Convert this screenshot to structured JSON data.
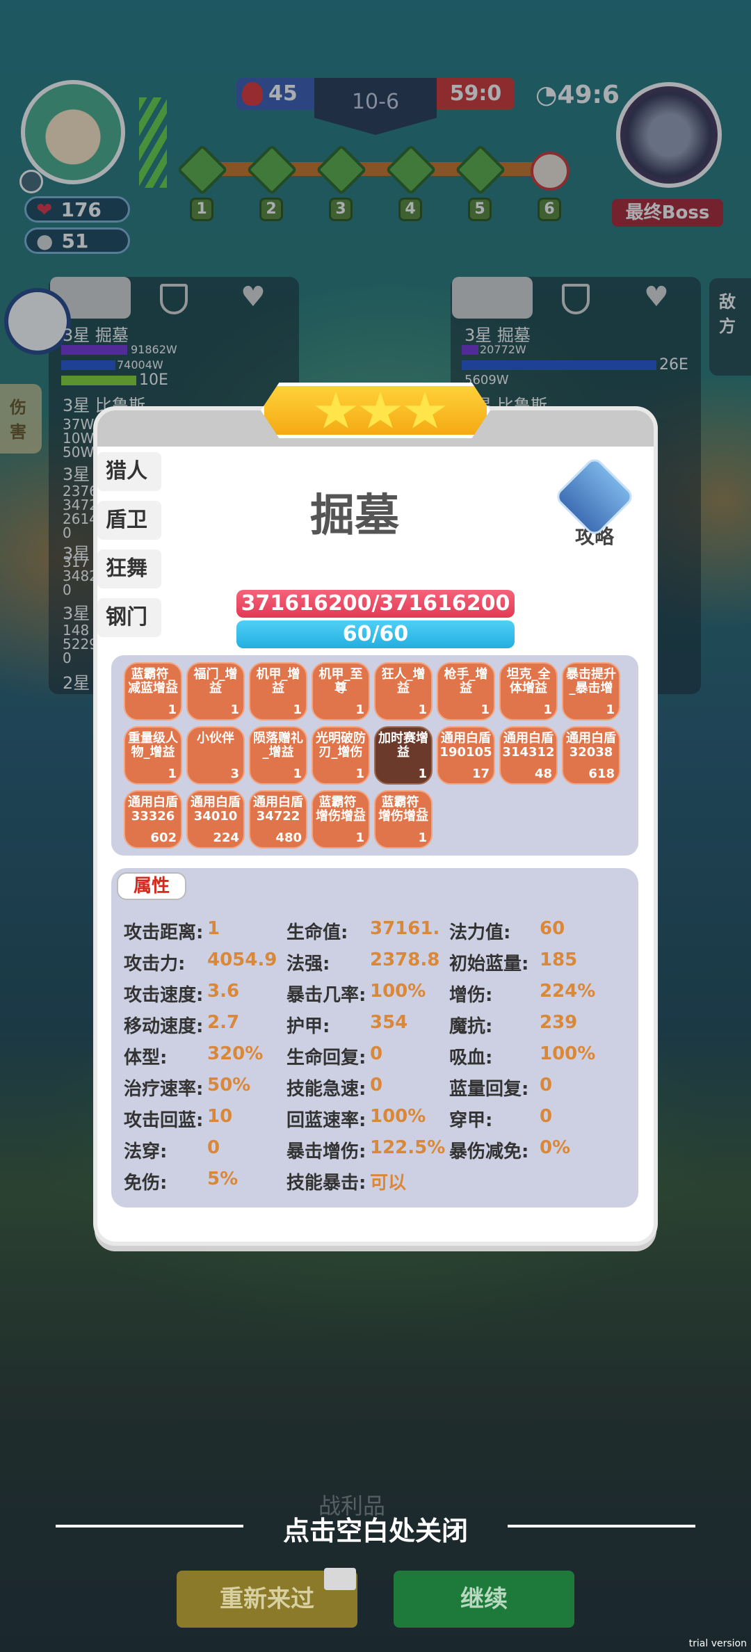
{
  "top": {
    "player_hp": "176",
    "player_coins": "51",
    "blue_score": "45",
    "round": "10-6",
    "red_score": "59:0",
    "timer": "49:6",
    "boss_label": "最终Boss",
    "nodes": [
      "1",
      "2",
      "3",
      "4",
      "5",
      "6"
    ]
  },
  "left_panel": {
    "rows": [
      "3星 掘墓",
      "91862W",
      "74004W",
      "10E",
      "3星 比鲁斯",
      "37W",
      "10W",
      "50W",
      "3星",
      "2376",
      "3472",
      "2614",
      "0",
      "3星",
      "317",
      "3482",
      "0",
      "3星",
      "148",
      "5229",
      "0",
      "2星"
    ],
    "side_tab": "伤害"
  },
  "right_panel": {
    "rows": [
      "3星 掘墓",
      "20772W",
      "26E",
      "5609W",
      "3星 比鲁斯"
    ],
    "side_tab": "敌方"
  },
  "modal": {
    "side_tabs": [
      "猎人",
      "盾卫",
      "狂舞",
      "钢门"
    ],
    "hero_name": "掘墓",
    "guide_label": "攻略",
    "hp": "371616200/371616200",
    "mana": "60/60",
    "buffs": [
      {
        "label": "蓝霸符_\n减蓝增益",
        "count": "1"
      },
      {
        "label": "福门_增\n益",
        "count": "1"
      },
      {
        "label": "机甲_增\n益",
        "count": "1"
      },
      {
        "label": "机甲_至\n尊",
        "count": "1"
      },
      {
        "label": "狂人_增\n益",
        "count": "1"
      },
      {
        "label": "枪手_增\n益",
        "count": "1"
      },
      {
        "label": "坦克_全\n体增益",
        "count": "1"
      },
      {
        "label": "暴击提升\n_暴击增",
        "count": "1"
      },
      {
        "label": "重量级人\n物_增益",
        "count": "1"
      },
      {
        "label": "小伙伴",
        "count": "3"
      },
      {
        "label": "陨落赠礼\n_增益",
        "count": "1"
      },
      {
        "label": "光明破防\n刃_增伤",
        "count": "1"
      },
      {
        "label": "加时赛增\n益",
        "count": "1"
      },
      {
        "label": "通用白盾\n190105",
        "count": "17"
      },
      {
        "label": "通用白盾\n314312",
        "count": "48"
      },
      {
        "label": "通用白盾\n32038",
        "count": "618"
      },
      {
        "label": "通用白盾\n33326",
        "count": "602"
      },
      {
        "label": "通用白盾\n34010",
        "count": "224"
      },
      {
        "label": "通用白盾\n34722",
        "count": "480"
      },
      {
        "label": "蓝霸符_\n增伤增益",
        "count": "1"
      },
      {
        "label": "蓝霸符_\n增伤增益",
        "count": "1"
      }
    ],
    "attr_title": "属性",
    "attrs": [
      {
        "k": "攻击距离:",
        "v": "1"
      },
      {
        "k": "生命值:",
        "v": "37161."
      },
      {
        "k": "法力值:",
        "v": "60"
      },
      {
        "k": "攻击力:",
        "v": "4054.9"
      },
      {
        "k": "法强:",
        "v": "2378.8"
      },
      {
        "k": "初始蓝量:",
        "v": "185"
      },
      {
        "k": "攻击速度:",
        "v": "3.6"
      },
      {
        "k": "暴击几率:",
        "v": "100%"
      },
      {
        "k": "增伤:",
        "v": "224%"
      },
      {
        "k": "移动速度:",
        "v": "2.7"
      },
      {
        "k": "护甲:",
        "v": "354"
      },
      {
        "k": "魔抗:",
        "v": "239"
      },
      {
        "k": "体型:",
        "v": "320%"
      },
      {
        "k": "生命回复:",
        "v": "0"
      },
      {
        "k": "吸血:",
        "v": "100%"
      },
      {
        "k": "治疗速率:",
        "v": "50%"
      },
      {
        "k": "技能急速:",
        "v": "0"
      },
      {
        "k": "蓝量回复:",
        "v": "0"
      },
      {
        "k": "攻击回蓝:",
        "v": "10"
      },
      {
        "k": "回蓝速率:",
        "v": "100%"
      },
      {
        "k": "穿甲:",
        "v": "0"
      },
      {
        "k": "法穿:",
        "v": "0"
      },
      {
        "k": "暴击增伤:",
        "v": "122.5%"
      },
      {
        "k": "暴伤减免:",
        "v": "0%"
      },
      {
        "k": "免伤:",
        "v": "5%"
      },
      {
        "k": "技能暴击:",
        "v": "可以"
      }
    ]
  },
  "bottom": {
    "close_hint": "点击空白处关闭",
    "behind_label": "战利品",
    "retry": "重新来过",
    "continue": "继续",
    "trial": "trial version"
  }
}
